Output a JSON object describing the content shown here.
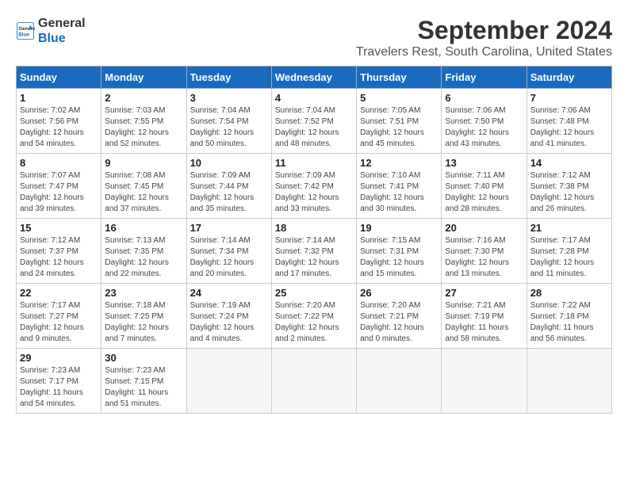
{
  "logo": {
    "text_general": "General",
    "text_blue": "Blue"
  },
  "title": "September 2024",
  "subtitle": "Travelers Rest, South Carolina, United States",
  "days_of_week": [
    "Sunday",
    "Monday",
    "Tuesday",
    "Wednesday",
    "Thursday",
    "Friday",
    "Saturday"
  ],
  "weeks": [
    [
      {
        "day": "1",
        "sunrise": "7:02 AM",
        "sunset": "7:56 PM",
        "daylight": "12 hours and 54 minutes."
      },
      {
        "day": "2",
        "sunrise": "7:03 AM",
        "sunset": "7:55 PM",
        "daylight": "12 hours and 52 minutes."
      },
      {
        "day": "3",
        "sunrise": "7:04 AM",
        "sunset": "7:54 PM",
        "daylight": "12 hours and 50 minutes."
      },
      {
        "day": "4",
        "sunrise": "7:04 AM",
        "sunset": "7:52 PM",
        "daylight": "12 hours and 48 minutes."
      },
      {
        "day": "5",
        "sunrise": "7:05 AM",
        "sunset": "7:51 PM",
        "daylight": "12 hours and 45 minutes."
      },
      {
        "day": "6",
        "sunrise": "7:06 AM",
        "sunset": "7:50 PM",
        "daylight": "12 hours and 43 minutes."
      },
      {
        "day": "7",
        "sunrise": "7:06 AM",
        "sunset": "7:48 PM",
        "daylight": "12 hours and 41 minutes."
      }
    ],
    [
      {
        "day": "8",
        "sunrise": "7:07 AM",
        "sunset": "7:47 PM",
        "daylight": "12 hours and 39 minutes."
      },
      {
        "day": "9",
        "sunrise": "7:08 AM",
        "sunset": "7:45 PM",
        "daylight": "12 hours and 37 minutes."
      },
      {
        "day": "10",
        "sunrise": "7:09 AM",
        "sunset": "7:44 PM",
        "daylight": "12 hours and 35 minutes."
      },
      {
        "day": "11",
        "sunrise": "7:09 AM",
        "sunset": "7:42 PM",
        "daylight": "12 hours and 33 minutes."
      },
      {
        "day": "12",
        "sunrise": "7:10 AM",
        "sunset": "7:41 PM",
        "daylight": "12 hours and 30 minutes."
      },
      {
        "day": "13",
        "sunrise": "7:11 AM",
        "sunset": "7:40 PM",
        "daylight": "12 hours and 28 minutes."
      },
      {
        "day": "14",
        "sunrise": "7:12 AM",
        "sunset": "7:38 PM",
        "daylight": "12 hours and 26 minutes."
      }
    ],
    [
      {
        "day": "15",
        "sunrise": "7:12 AM",
        "sunset": "7:37 PM",
        "daylight": "12 hours and 24 minutes."
      },
      {
        "day": "16",
        "sunrise": "7:13 AM",
        "sunset": "7:35 PM",
        "daylight": "12 hours and 22 minutes."
      },
      {
        "day": "17",
        "sunrise": "7:14 AM",
        "sunset": "7:34 PM",
        "daylight": "12 hours and 20 minutes."
      },
      {
        "day": "18",
        "sunrise": "7:14 AM",
        "sunset": "7:32 PM",
        "daylight": "12 hours and 17 minutes."
      },
      {
        "day": "19",
        "sunrise": "7:15 AM",
        "sunset": "7:31 PM",
        "daylight": "12 hours and 15 minutes."
      },
      {
        "day": "20",
        "sunrise": "7:16 AM",
        "sunset": "7:30 PM",
        "daylight": "12 hours and 13 minutes."
      },
      {
        "day": "21",
        "sunrise": "7:17 AM",
        "sunset": "7:28 PM",
        "daylight": "12 hours and 11 minutes."
      }
    ],
    [
      {
        "day": "22",
        "sunrise": "7:17 AM",
        "sunset": "7:27 PM",
        "daylight": "12 hours and 9 minutes."
      },
      {
        "day": "23",
        "sunrise": "7:18 AM",
        "sunset": "7:25 PM",
        "daylight": "12 hours and 7 minutes."
      },
      {
        "day": "24",
        "sunrise": "7:19 AM",
        "sunset": "7:24 PM",
        "daylight": "12 hours and 4 minutes."
      },
      {
        "day": "25",
        "sunrise": "7:20 AM",
        "sunset": "7:22 PM",
        "daylight": "12 hours and 2 minutes."
      },
      {
        "day": "26",
        "sunrise": "7:20 AM",
        "sunset": "7:21 PM",
        "daylight": "12 hours and 0 minutes."
      },
      {
        "day": "27",
        "sunrise": "7:21 AM",
        "sunset": "7:19 PM",
        "daylight": "11 hours and 58 minutes."
      },
      {
        "day": "28",
        "sunrise": "7:22 AM",
        "sunset": "7:18 PM",
        "daylight": "11 hours and 56 minutes."
      }
    ],
    [
      {
        "day": "29",
        "sunrise": "7:23 AM",
        "sunset": "7:17 PM",
        "daylight": "11 hours and 54 minutes."
      },
      {
        "day": "30",
        "sunrise": "7:23 AM",
        "sunset": "7:15 PM",
        "daylight": "11 hours and 51 minutes."
      },
      null,
      null,
      null,
      null,
      null
    ]
  ]
}
